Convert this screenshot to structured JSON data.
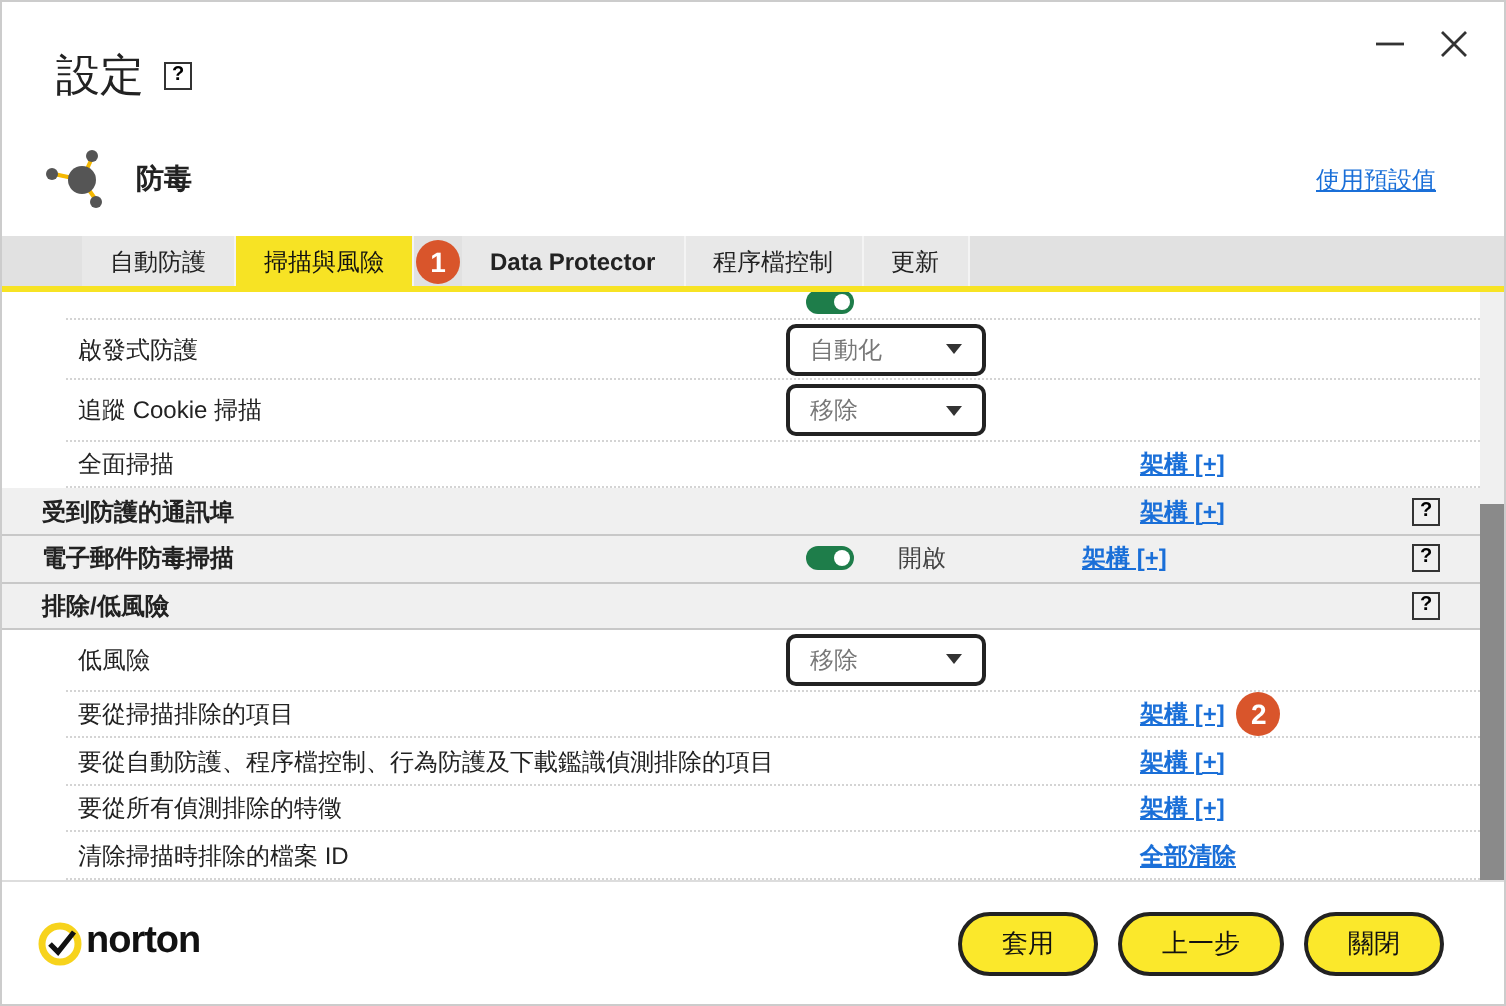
{
  "window": {
    "title": "設定",
    "help": "?"
  },
  "section": {
    "title": "防毒",
    "reset_link": "使用預設值"
  },
  "tabs": [
    {
      "label": "自動防護",
      "selected": false
    },
    {
      "label": "掃描與風險",
      "selected": true,
      "badge": "1"
    },
    {
      "label": "Data Protector",
      "selected": false
    },
    {
      "label": "程序檔控制",
      "selected": false
    },
    {
      "label": "更新",
      "selected": false
    }
  ],
  "rows": [
    {
      "kind": "clipped",
      "toggle": true
    },
    {
      "kind": "item",
      "label": "啟發式防護",
      "dropdown": "自動化"
    },
    {
      "kind": "item",
      "label": "追蹤 Cookie 掃描",
      "dropdown": "移除"
    },
    {
      "kind": "item",
      "label": "全面掃描",
      "link": "架構 [+]"
    },
    {
      "kind": "section",
      "label": "受到防護的通訊埠",
      "link": "架構 [+]",
      "help": "?"
    },
    {
      "kind": "section",
      "label": "電子郵件防毒掃描",
      "toggle": true,
      "status": "開啟",
      "link": "架構 [+]",
      "help": "?"
    },
    {
      "kind": "section",
      "label": "排除/低風險",
      "help": "?"
    },
    {
      "kind": "item",
      "label": "低風險",
      "dropdown": "移除"
    },
    {
      "kind": "item",
      "label": "要從掃描排除的項目",
      "link": "架構 [+]",
      "badge": "2"
    },
    {
      "kind": "item",
      "label": "要從自動防護、程序檔控制、行為防護及下載鑑識偵測排除的項目",
      "link": "架構 [+]"
    },
    {
      "kind": "item",
      "label": "要從所有偵測排除的特徵",
      "link": "架構 [+]"
    },
    {
      "kind": "item",
      "label": "清除掃描時排除的檔案 ID",
      "link": "全部清除"
    }
  ],
  "footer": {
    "logo": "norton",
    "buttons": [
      "套用",
      "上一步",
      "關閉"
    ]
  }
}
